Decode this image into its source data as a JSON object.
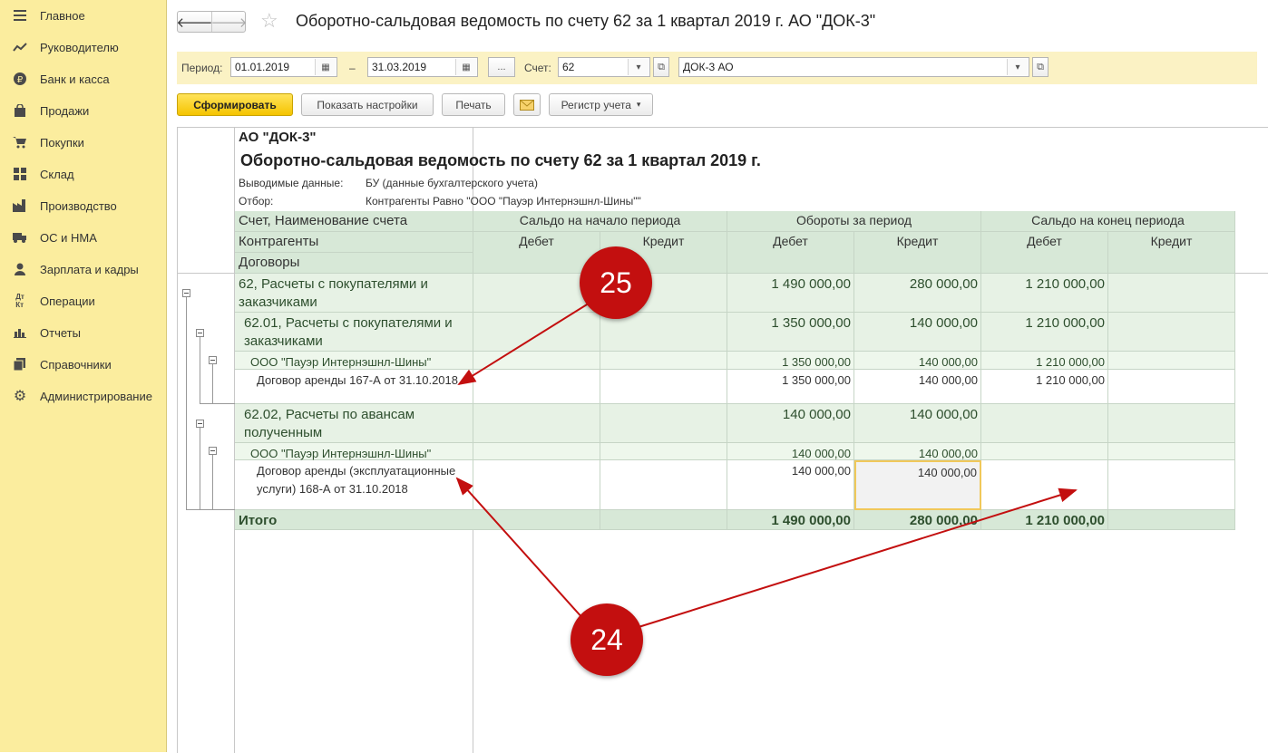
{
  "sidebar": {
    "items": [
      {
        "label": "Главное",
        "icon": "menu-icon"
      },
      {
        "label": "Руководителю",
        "icon": "trend-icon"
      },
      {
        "label": "Банк и касса",
        "icon": "ruble-icon"
      },
      {
        "label": "Продажи",
        "icon": "bag-icon"
      },
      {
        "label": "Покупки",
        "icon": "cart-icon"
      },
      {
        "label": "Склад",
        "icon": "grid-icon"
      },
      {
        "label": "Производство",
        "icon": "factory-icon"
      },
      {
        "label": "ОС и НМА",
        "icon": "truck-icon"
      },
      {
        "label": "Зарплата и кадры",
        "icon": "person-icon"
      },
      {
        "label": "Операции",
        "icon": "dt-kt-icon"
      },
      {
        "label": "Отчеты",
        "icon": "bar-chart-icon"
      },
      {
        "label": "Справочники",
        "icon": "books-icon"
      },
      {
        "label": "Администрирование",
        "icon": "gear-icon"
      }
    ]
  },
  "header": {
    "title": "Оборотно-сальдовая ведомость по счету 62 за 1 квартал 2019 г. АО \"ДОК-3\""
  },
  "params": {
    "period_label": "Период:",
    "date_from": "01.01.2019",
    "dash": "–",
    "date_to": "31.03.2019",
    "period_button": "...",
    "account_label": "Счет:",
    "account_value": "62",
    "org_value": "ДОК-3 АО"
  },
  "toolbar": {
    "generate": "Сформировать",
    "show_settings": "Показать настройки",
    "print": "Печать",
    "register": "Регистр учета"
  },
  "report": {
    "org": "АО \"ДОК-3\"",
    "title": "Оборотно-сальдовая ведомость по счету 62 за 1 квартал 2019 г.",
    "output_label": "Выводимые данные:",
    "output_value": "БУ (данные бухгалтерского учета)",
    "filter_label": "Отбор:",
    "filter_value": "Контрагенты Равно \"ООО \"Пауэр Интернэшнл-Шины\"\"",
    "headers": {
      "account": "Счет, Наименование счета",
      "counterparties": "Контрагенты",
      "contracts": "Договоры",
      "opening": "Сальдо на начало периода",
      "turnover": "Обороты за период",
      "closing": "Сальдо на конец периода",
      "debit": "Дебет",
      "credit": "Кредит"
    },
    "rows": [
      {
        "name": "62, Расчеты с покупателями и заказчиками",
        "values": [
          "",
          "",
          "1 490 000,00",
          "280 000,00",
          "1 210 000,00",
          ""
        ]
      },
      {
        "name": "62.01, Расчеты с покупателями и заказчиками",
        "values": [
          "",
          "",
          "1 350 000,00",
          "140 000,00",
          "1 210 000,00",
          ""
        ]
      },
      {
        "name": "ООО \"Пауэр Интернэшнл-Шины\"",
        "values": [
          "",
          "",
          "1 350 000,00",
          "140 000,00",
          "1 210 000,00",
          ""
        ]
      },
      {
        "name": "Договор аренды 167-А от 31.10.2018",
        "values": [
          "",
          "",
          "1 350 000,00",
          "140 000,00",
          "1 210 000,00",
          ""
        ]
      },
      {
        "name": "62.02, Расчеты по авансам полученным",
        "values": [
          "",
          "",
          "140 000,00",
          "140 000,00",
          "",
          ""
        ]
      },
      {
        "name": "ООО \"Пауэр Интернэшнл-Шины\"",
        "values": [
          "",
          "",
          "140 000,00",
          "140 000,00",
          "",
          ""
        ]
      },
      {
        "name": "Договор аренды (эксплуатационные услуги) 168-А от 31.10.2018",
        "values": [
          "",
          "",
          "140 000,00",
          "140 000,00",
          "",
          ""
        ]
      }
    ],
    "total": {
      "name": "Итого",
      "values": [
        "",
        "",
        "1 490 000,00",
        "280 000,00",
        "1 210 000,00",
        ""
      ]
    }
  },
  "annotations": {
    "marker_25": "25",
    "marker_24": "24",
    "arrow_color": "#c30f0f"
  }
}
